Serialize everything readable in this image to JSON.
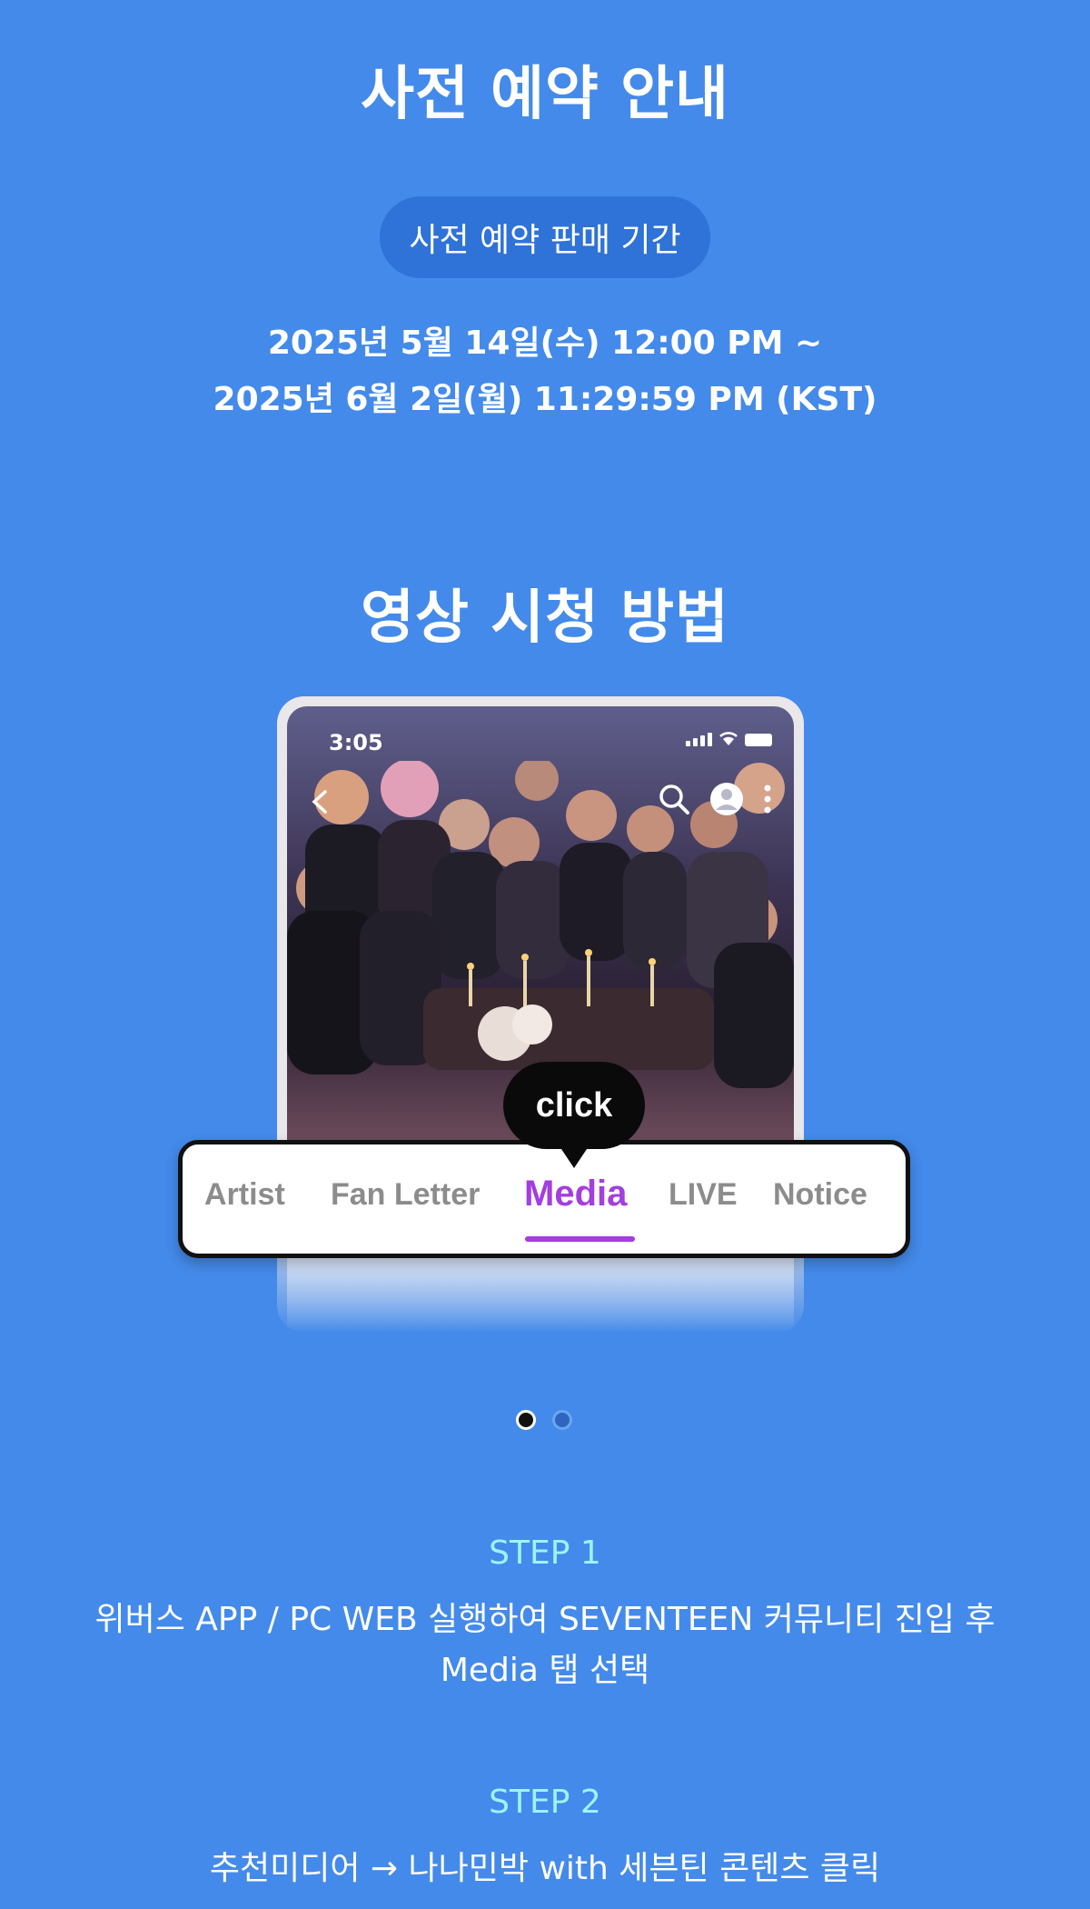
{
  "preorder": {
    "title": "사전 예약 안내",
    "period_label": "사전 예약 판매 기간",
    "period_start": "2025년 5월 14일(수) 12:00 PM ~",
    "period_end": "2025년 6월 2일(월) 11:29:59 PM (KST)"
  },
  "howto": {
    "title": "영상 시청 방법"
  },
  "mockup": {
    "status_time": "3:05",
    "tabs": [
      "Artist",
      "Fan Letter",
      "Media",
      "LIVE",
      "Notice"
    ],
    "active_tab": "Media",
    "click_label": "click",
    "accent_color": "#a33ee0"
  },
  "carousel": {
    "page_count": 2,
    "active_page": 1
  },
  "steps": [
    {
      "label": "STEP 1",
      "text_line1": "위버스 APP / PC WEB 실행하여 SEVENTEEN 커뮤니티 진입 후",
      "text_line2": "Media 탭 선택"
    },
    {
      "label": "STEP 2",
      "text_line1": "추천미디어 → 나나민박 with 세븐틴 콘텐츠 클릭"
    }
  ],
  "colors": {
    "background": "#448aea",
    "badge": "#2f72d8",
    "step_label": "#9ff2ff"
  }
}
